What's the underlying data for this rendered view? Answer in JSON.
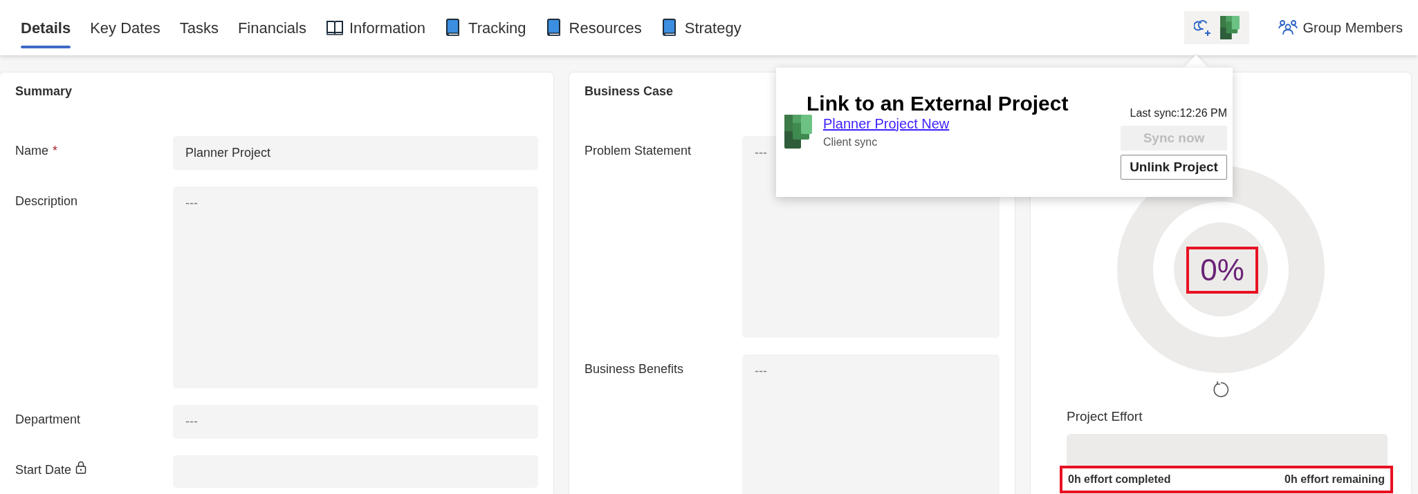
{
  "tabs": [
    {
      "label": "Details",
      "selected": true,
      "kind": "plain"
    },
    {
      "label": "Key Dates",
      "selected": false,
      "kind": "plain"
    },
    {
      "label": "Tasks",
      "selected": false,
      "kind": "plain"
    },
    {
      "label": "Financials",
      "selected": false,
      "kind": "plain"
    },
    {
      "label": "Information",
      "selected": false,
      "kind": "open-book"
    },
    {
      "label": "Tracking",
      "selected": false,
      "kind": "book"
    },
    {
      "label": "Resources",
      "selected": false,
      "kind": "book"
    },
    {
      "label": "Strategy",
      "selected": false,
      "kind": "book"
    }
  ],
  "toolbar": {
    "group_members": "Group Members"
  },
  "summary": {
    "title": "Summary",
    "required_marker": "*",
    "fields": [
      {
        "label": "Name",
        "required": true,
        "locked": false,
        "kind": "input",
        "value": "Planner Project"
      },
      {
        "label": "Description",
        "required": false,
        "locked": false,
        "kind": "textarea",
        "placeholder": "---"
      },
      {
        "label": "Department",
        "required": false,
        "locked": false,
        "kind": "input",
        "placeholder": "---"
      },
      {
        "label": "Start Date",
        "required": false,
        "locked": true,
        "kind": "input"
      }
    ]
  },
  "business_case": {
    "title": "Business Case",
    "fields": [
      {
        "label": "Problem Statement",
        "required": false,
        "locked": false,
        "kind": "textarea",
        "placeholder": "---"
      },
      {
        "label": "Business Benefits",
        "required": false,
        "locked": false,
        "kind": "textarea",
        "placeholder": "---"
      }
    ]
  },
  "progress": {
    "percent": "0%",
    "percent_highlighted": true,
    "effort_label": "Project Effort",
    "completed": "0h effort completed",
    "remaining": "0h effort remaining",
    "effort_highlighted": true
  },
  "popup": {
    "title": "Link to an External Project",
    "project_link": "Planner Project New",
    "sync_mode": "Client sync",
    "last_sync": "Last sync:12:26 PM",
    "buttons": [
      {
        "label": "Sync now",
        "disabled": true
      },
      {
        "label": "Unlink Project",
        "disabled": false
      }
    ]
  }
}
